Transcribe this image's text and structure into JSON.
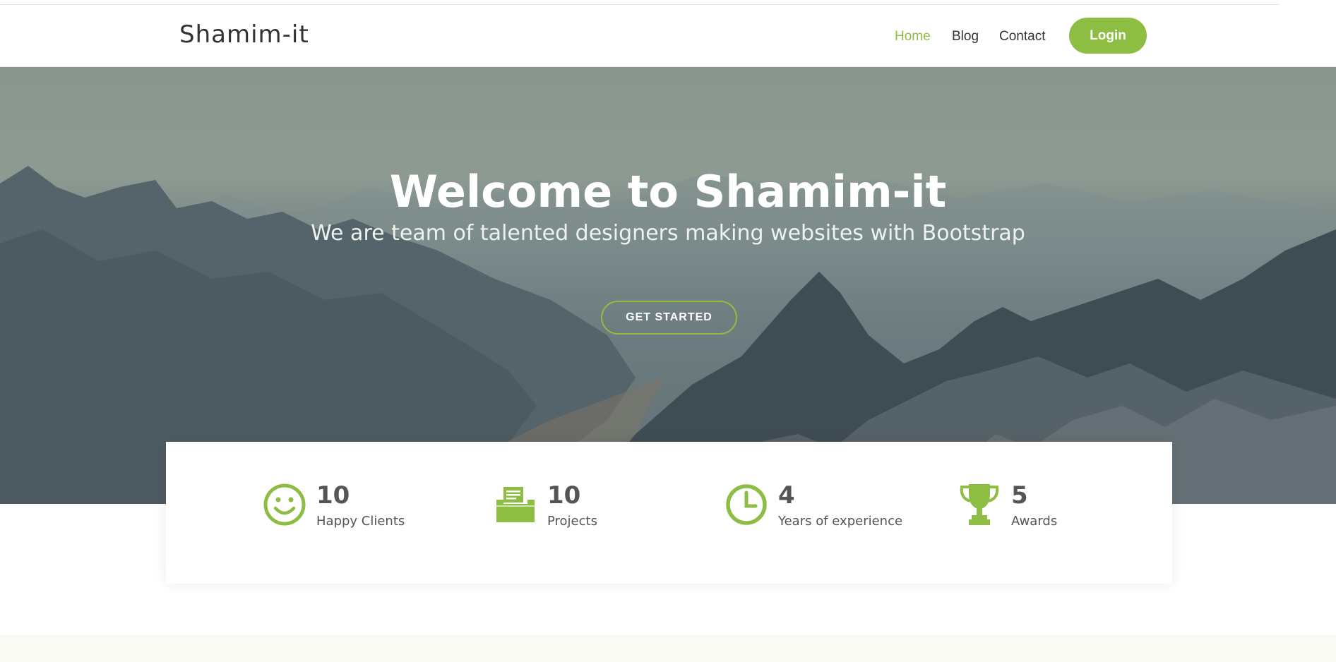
{
  "brand": {
    "name": "Shamim-it",
    "accent": "#8dbd43"
  },
  "nav": {
    "items": [
      {
        "label": "Home",
        "active": true
      },
      {
        "label": "Blog",
        "active": false
      },
      {
        "label": "Contact",
        "active": false
      }
    ],
    "login_label": "Login"
  },
  "hero": {
    "title": "Welcome to Shamim-it",
    "subtitle": "We are team of talented designers making websites with Bootstrap",
    "cta_label": "GET STARTED"
  },
  "stats": [
    {
      "icon": "smiley-icon",
      "value": "10",
      "label": "Happy Clients"
    },
    {
      "icon": "folder-icon",
      "value": "10",
      "label": "Projects"
    },
    {
      "icon": "clock-icon",
      "value": "4",
      "label": "Years of experience"
    },
    {
      "icon": "trophy-icon",
      "value": "5",
      "label": "Awards"
    }
  ]
}
